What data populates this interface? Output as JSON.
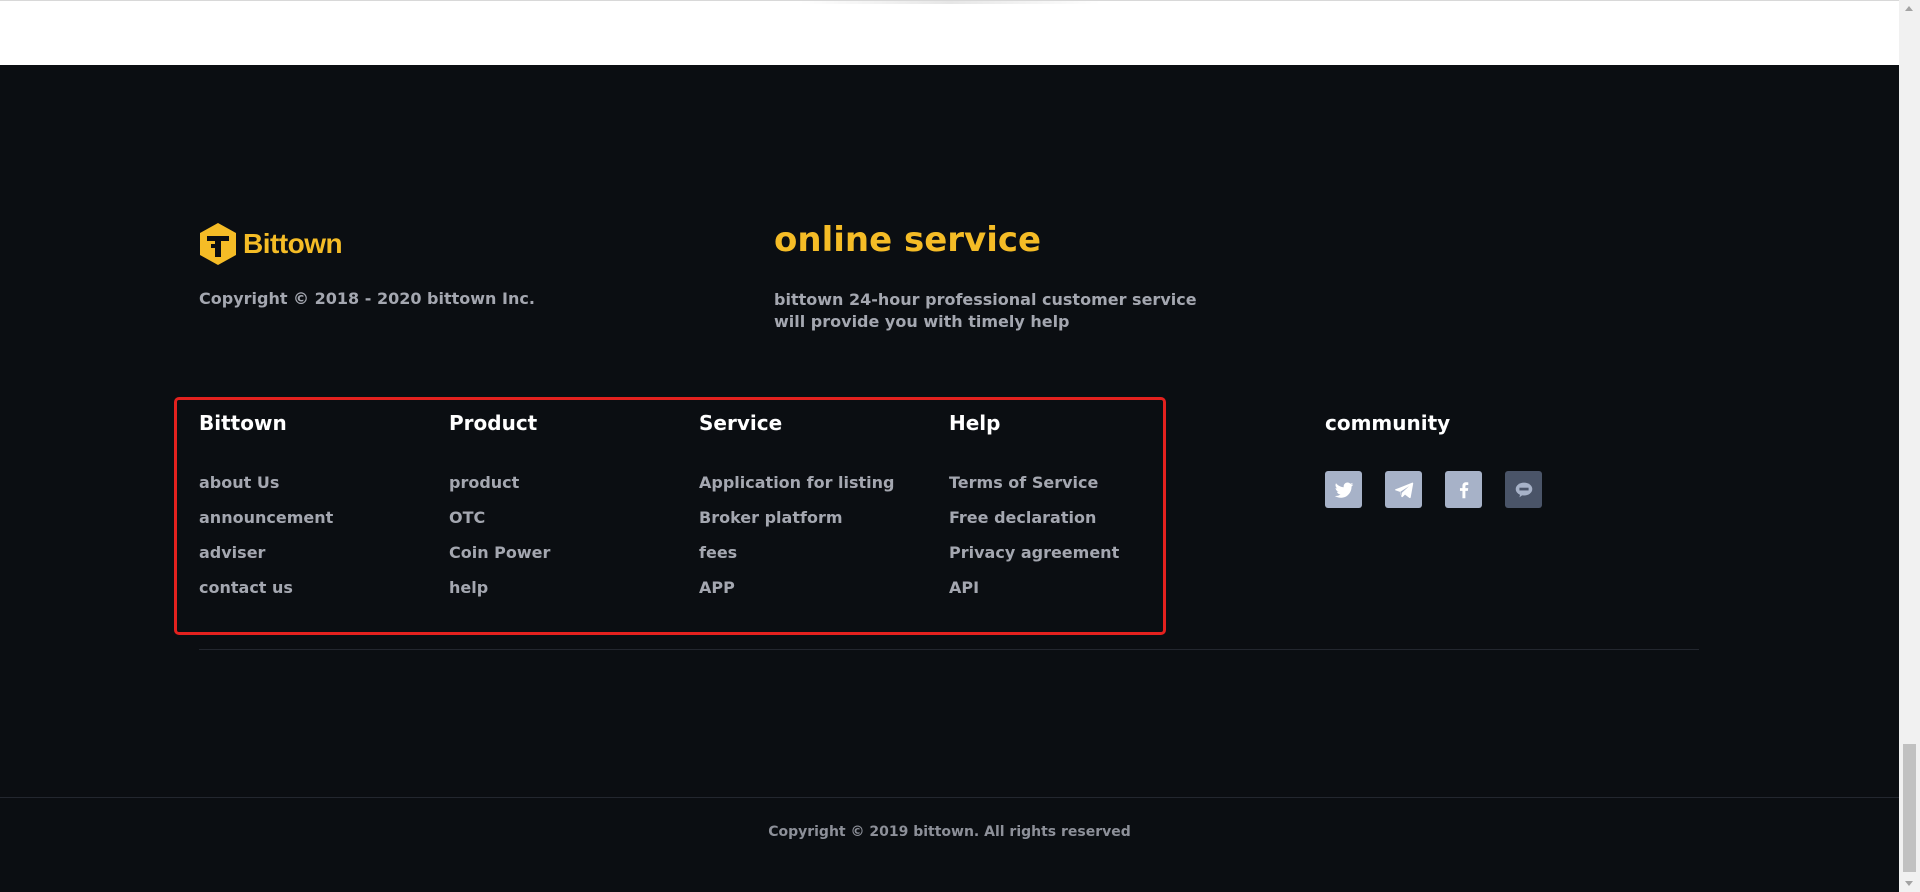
{
  "brand": {
    "name": "Bittown",
    "copyright": "Copyright © 2018 - 2020 bittown Inc."
  },
  "online_service": {
    "title": "online service",
    "description": "bittown 24-hour professional customer service will provide you with timely help"
  },
  "columns": [
    {
      "title": "Bittown",
      "links": [
        "about Us",
        "announcement",
        "adviser",
        "contact us"
      ]
    },
    {
      "title": "Product",
      "links": [
        "product",
        "OTC",
        "Coin Power",
        "help"
      ]
    },
    {
      "title": "Service",
      "links": [
        "Application for listing",
        "Broker platform",
        "fees",
        "APP"
      ]
    },
    {
      "title": "Help",
      "links": [
        "Terms of Service",
        "Free declaration",
        "Privacy agreement",
        "API"
      ]
    }
  ],
  "community": {
    "title": "community",
    "icons": [
      "twitter-icon",
      "telegram-icon",
      "facebook-icon",
      "kakaotalk-icon"
    ]
  },
  "bottom": {
    "copyright": "Copyright © 2019 bittown. All rights reserved"
  },
  "colors": {
    "background": "#0b0e12",
    "accent": "#f5bc26",
    "highlight": "#e3211e",
    "text_muted": "#a4a7b0",
    "social_bg": "#a7b2c8"
  }
}
